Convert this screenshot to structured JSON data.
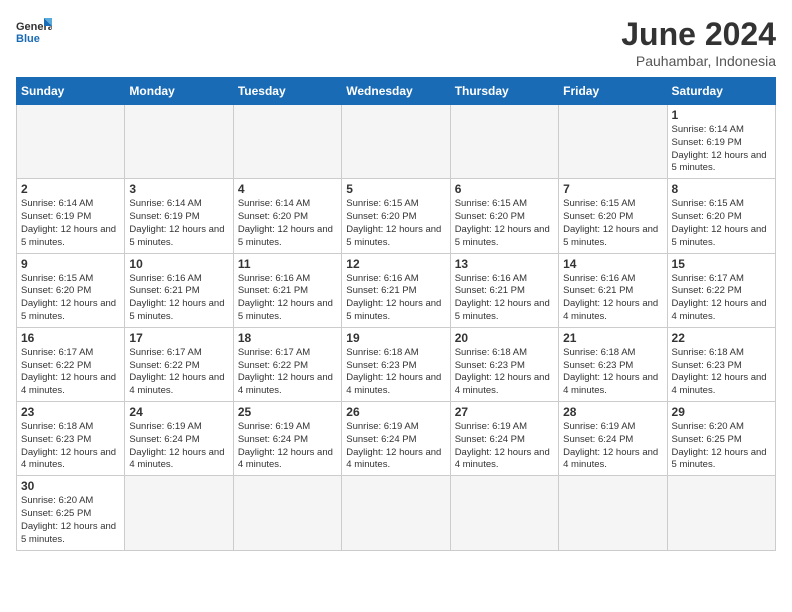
{
  "logo": {
    "text_general": "General",
    "text_blue": "Blue"
  },
  "title": "June 2024",
  "subtitle": "Pauhambar, Indonesia",
  "days_of_week": [
    "Sunday",
    "Monday",
    "Tuesday",
    "Wednesday",
    "Thursday",
    "Friday",
    "Saturday"
  ],
  "weeks": [
    [
      {
        "day": "",
        "info": ""
      },
      {
        "day": "",
        "info": ""
      },
      {
        "day": "",
        "info": ""
      },
      {
        "day": "",
        "info": ""
      },
      {
        "day": "",
        "info": ""
      },
      {
        "day": "",
        "info": ""
      },
      {
        "day": "1",
        "info": "Sunrise: 6:14 AM\nSunset: 6:19 PM\nDaylight: 12 hours\nand 5 minutes."
      }
    ],
    [
      {
        "day": "2",
        "info": "Sunrise: 6:14 AM\nSunset: 6:19 PM\nDaylight: 12 hours\nand 5 minutes."
      },
      {
        "day": "3",
        "info": "Sunrise: 6:14 AM\nSunset: 6:19 PM\nDaylight: 12 hours\nand 5 minutes."
      },
      {
        "day": "4",
        "info": "Sunrise: 6:14 AM\nSunset: 6:20 PM\nDaylight: 12 hours\nand 5 minutes."
      },
      {
        "day": "5",
        "info": "Sunrise: 6:15 AM\nSunset: 6:20 PM\nDaylight: 12 hours\nand 5 minutes."
      },
      {
        "day": "6",
        "info": "Sunrise: 6:15 AM\nSunset: 6:20 PM\nDaylight: 12 hours\nand 5 minutes."
      },
      {
        "day": "7",
        "info": "Sunrise: 6:15 AM\nSunset: 6:20 PM\nDaylight: 12 hours\nand 5 minutes."
      },
      {
        "day": "8",
        "info": "Sunrise: 6:15 AM\nSunset: 6:20 PM\nDaylight: 12 hours\nand 5 minutes."
      }
    ],
    [
      {
        "day": "9",
        "info": "Sunrise: 6:15 AM\nSunset: 6:20 PM\nDaylight: 12 hours\nand 5 minutes."
      },
      {
        "day": "10",
        "info": "Sunrise: 6:16 AM\nSunset: 6:21 PM\nDaylight: 12 hours\nand 5 minutes."
      },
      {
        "day": "11",
        "info": "Sunrise: 6:16 AM\nSunset: 6:21 PM\nDaylight: 12 hours\nand 5 minutes."
      },
      {
        "day": "12",
        "info": "Sunrise: 6:16 AM\nSunset: 6:21 PM\nDaylight: 12 hours\nand 5 minutes."
      },
      {
        "day": "13",
        "info": "Sunrise: 6:16 AM\nSunset: 6:21 PM\nDaylight: 12 hours\nand 5 minutes."
      },
      {
        "day": "14",
        "info": "Sunrise: 6:16 AM\nSunset: 6:21 PM\nDaylight: 12 hours\nand 4 minutes."
      },
      {
        "day": "15",
        "info": "Sunrise: 6:17 AM\nSunset: 6:22 PM\nDaylight: 12 hours\nand 4 minutes."
      }
    ],
    [
      {
        "day": "16",
        "info": "Sunrise: 6:17 AM\nSunset: 6:22 PM\nDaylight: 12 hours\nand 4 minutes."
      },
      {
        "day": "17",
        "info": "Sunrise: 6:17 AM\nSunset: 6:22 PM\nDaylight: 12 hours\nand 4 minutes."
      },
      {
        "day": "18",
        "info": "Sunrise: 6:17 AM\nSunset: 6:22 PM\nDaylight: 12 hours\nand 4 minutes."
      },
      {
        "day": "19",
        "info": "Sunrise: 6:18 AM\nSunset: 6:23 PM\nDaylight: 12 hours\nand 4 minutes."
      },
      {
        "day": "20",
        "info": "Sunrise: 6:18 AM\nSunset: 6:23 PM\nDaylight: 12 hours\nand 4 minutes."
      },
      {
        "day": "21",
        "info": "Sunrise: 6:18 AM\nSunset: 6:23 PM\nDaylight: 12 hours\nand 4 minutes."
      },
      {
        "day": "22",
        "info": "Sunrise: 6:18 AM\nSunset: 6:23 PM\nDaylight: 12 hours\nand 4 minutes."
      }
    ],
    [
      {
        "day": "23",
        "info": "Sunrise: 6:18 AM\nSunset: 6:23 PM\nDaylight: 12 hours\nand 4 minutes."
      },
      {
        "day": "24",
        "info": "Sunrise: 6:19 AM\nSunset: 6:24 PM\nDaylight: 12 hours\nand 4 minutes."
      },
      {
        "day": "25",
        "info": "Sunrise: 6:19 AM\nSunset: 6:24 PM\nDaylight: 12 hours\nand 4 minutes."
      },
      {
        "day": "26",
        "info": "Sunrise: 6:19 AM\nSunset: 6:24 PM\nDaylight: 12 hours\nand 4 minutes."
      },
      {
        "day": "27",
        "info": "Sunrise: 6:19 AM\nSunset: 6:24 PM\nDaylight: 12 hours\nand 4 minutes."
      },
      {
        "day": "28",
        "info": "Sunrise: 6:19 AM\nSunset: 6:24 PM\nDaylight: 12 hours\nand 4 minutes."
      },
      {
        "day": "29",
        "info": "Sunrise: 6:20 AM\nSunset: 6:25 PM\nDaylight: 12 hours\nand 5 minutes."
      }
    ],
    [
      {
        "day": "30",
        "info": "Sunrise: 6:20 AM\nSunset: 6:25 PM\nDaylight: 12 hours\nand 5 minutes."
      },
      {
        "day": "",
        "info": ""
      },
      {
        "day": "",
        "info": ""
      },
      {
        "day": "",
        "info": ""
      },
      {
        "day": "",
        "info": ""
      },
      {
        "day": "",
        "info": ""
      },
      {
        "day": "",
        "info": ""
      }
    ]
  ]
}
